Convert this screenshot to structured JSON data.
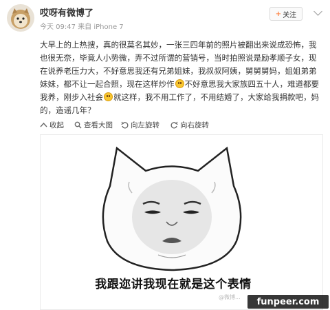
{
  "user": {
    "name": "哎呀有微博了",
    "time": "今天 09:47",
    "source_prefix": "来自",
    "source": "iPhone 7"
  },
  "follow_label": "关注",
  "post_text_parts": [
    "大早上的上热搜，真的很莫名其妙，一张三四年前的照片被翻出来说成恐怖，我也很无奈，毕竟人小势微，弄不过所谓的营销号，当时拍照说是励孝顺子女，现在说养老压力大，不好意思我还有兄弟姐妹，我叔叔阿姨，舅舅舅妈，姐姐弟弟妹妹，都不让一起合照，现在这样炒作",
    "不好意思我大家族四五十人，难道都要我养，刚步入社会",
    "就这样，我不用工作了，不用结婚了，大家给我捐款吧，妈的，造谣几年？"
  ],
  "toolbar": {
    "collapse": "收起",
    "view_large": "查看大图",
    "rotate_left": "向左旋转",
    "rotate_right": "向右旋转"
  },
  "image": {
    "caption": "我跟迩讲我现在就是这个表情",
    "watermark_small": "@微博...",
    "watermark": "funpeer.com"
  },
  "colors": {
    "accent": "#ff8140",
    "emoji": "#f8c630"
  }
}
